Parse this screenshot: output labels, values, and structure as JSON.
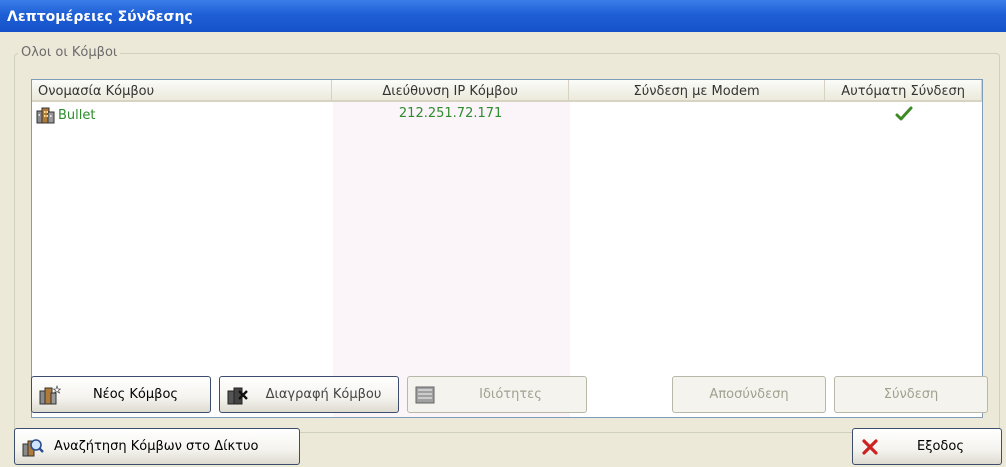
{
  "window": {
    "title": "Λεπτομέρειες Σύνδεσης"
  },
  "group": {
    "legend": "Ολοι οι Κόμβοι"
  },
  "table": {
    "columns": [
      "Ονομασία Κόμβου",
      "Διεύθυνση IP Κόμβου",
      "Σύνδεση με Modem",
      "Αυτόματη Σύνδεση"
    ],
    "rows": [
      {
        "name": "Bullet",
        "ip": "212.251.72.171",
        "modem": "",
        "auto_connect": true
      }
    ]
  },
  "buttons": {
    "new_node": "Νέος Κόμβος",
    "delete_node": "Διαγραφή Κόμβου",
    "properties": "Ιδιότητες",
    "disconnect": "Αποσύνδεση",
    "connect": "Σύνδεση",
    "search_network": "Αναζήτηση Κόμβων στο Δίκτυο",
    "exit": "Εξοδος"
  },
  "colors": {
    "title_bar": "#1f5fd6",
    "ok_green": "#2e8b2e",
    "exit_red": "#cc2222"
  },
  "icons": {
    "node": "building-icon",
    "new_node": "building-star-icon",
    "delete_node": "delete-node-icon",
    "properties": "properties-icon",
    "search": "search-network-icon",
    "exit": "red-x-icon",
    "check": "checkmark-icon"
  }
}
